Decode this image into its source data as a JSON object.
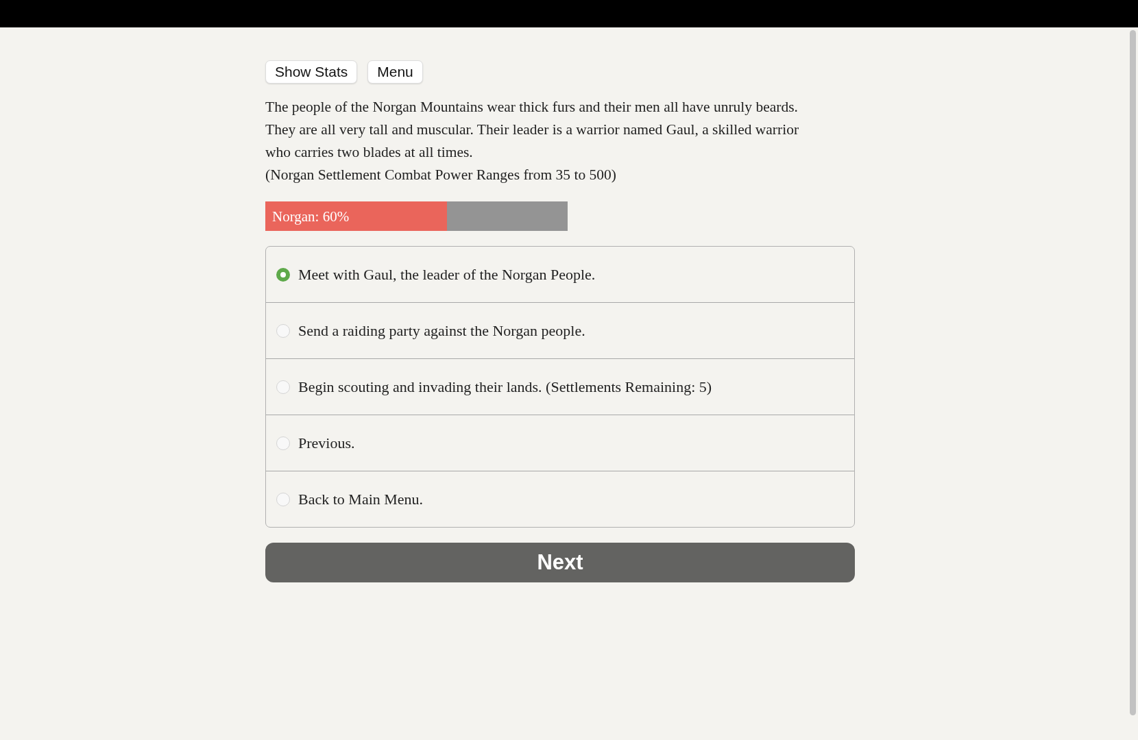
{
  "toolbar": {
    "buttons": [
      "Show Stats",
      "Menu"
    ]
  },
  "description": [
    "The people of the Norgan Mountains wear thick furs and their men all have unruly beards. They are all very tall and muscular. Their leader is a warrior named Gaul, a skilled warrior who carries two blades at all times.",
    "(Norgan Settlement Combat Power Ranges from 35 to 500)"
  ],
  "meter": {
    "label": "Norgan: 60%",
    "level": 0.6
  },
  "choices": [
    {
      "label": "Meet with Gaul, the leader of the Norgan People.",
      "selected": true
    },
    {
      "label": "Send a raiding party against the Norgan people.",
      "selected": false
    },
    {
      "label": "Begin scouting and invading their lands. (Settlements Remaining: 5)",
      "selected": false
    },
    {
      "label": "Previous.",
      "selected": false
    },
    {
      "label": "Back to Main Menu.",
      "selected": false
    }
  ],
  "next_button": "Next"
}
